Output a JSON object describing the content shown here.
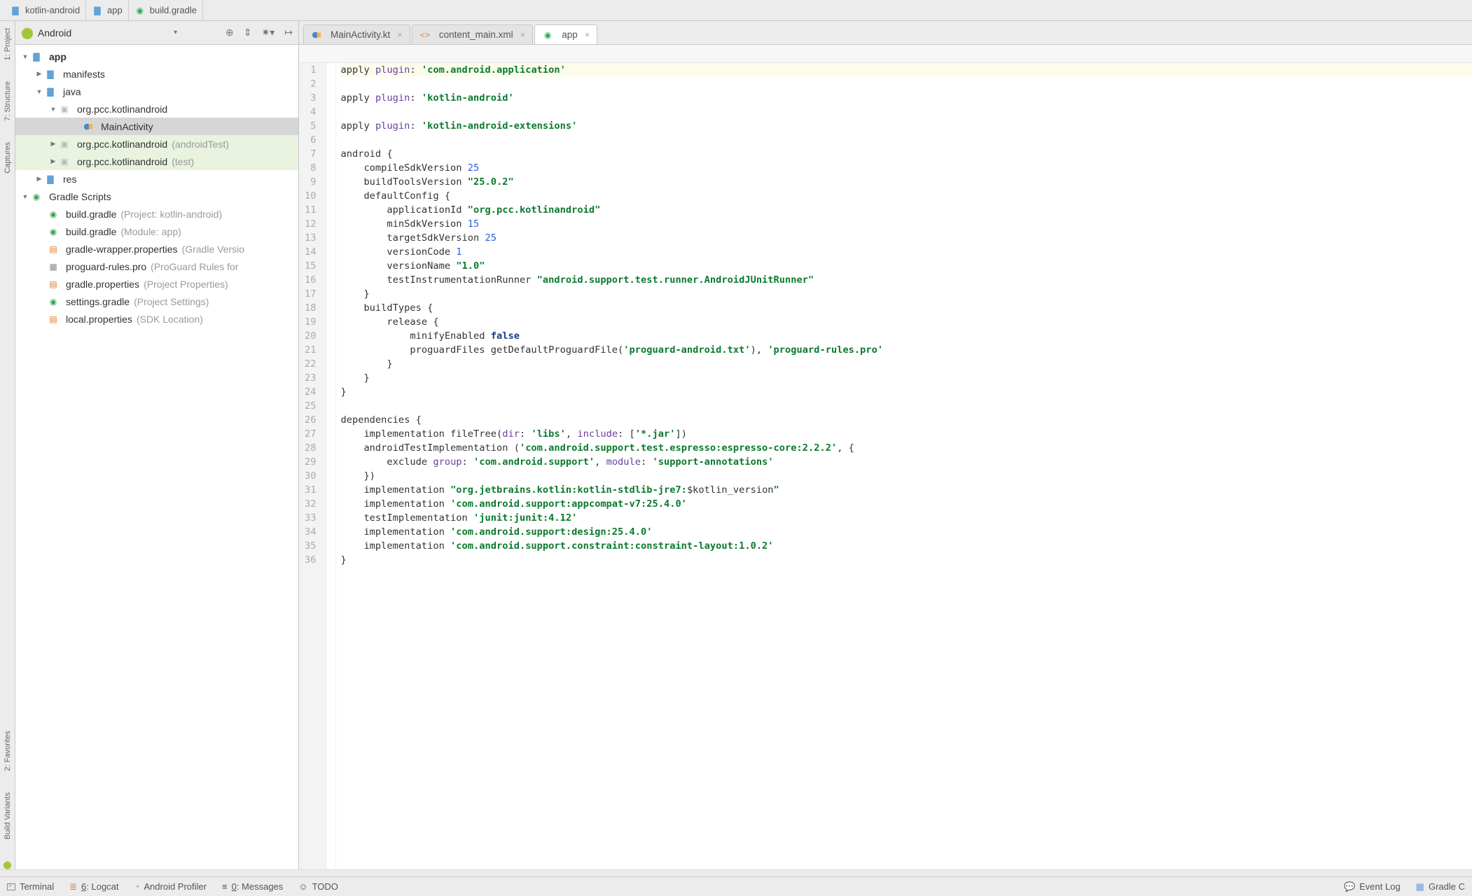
{
  "breadcrumb": {
    "proj": "kotlin-android",
    "mod": "app",
    "file": "build.gradle"
  },
  "projectHeader": {
    "mode": "Android"
  },
  "tree": {
    "app": "app",
    "manifests": "manifests",
    "java": "java",
    "pkg1": "org.pcc.kotlinandroid",
    "main": "MainActivity",
    "pkg2": "org.pcc.kotlinandroid",
    "pkg2q": "(androidTest)",
    "pkg3": "org.pcc.kotlinandroid",
    "pkg3q": "(test)",
    "res": "res",
    "gscripts": "Gradle Scripts",
    "bg1": "build.gradle",
    "bg1q": "(Project: kotlin-android)",
    "bg2": "build.gradle",
    "bg2q": "(Module: app)",
    "gw": "gradle-wrapper.properties",
    "gwq": "(Gradle Versio",
    "pg": "proguard-rules.pro",
    "pgq": "(ProGuard Rules for",
    "gp": "gradle.properties",
    "gpq": "(Project Properties)",
    "sg": "settings.gradle",
    "sgq": "(Project Settings)",
    "lp": "local.properties",
    "lpq": "(SDK Location)"
  },
  "tabs": {
    "t1": "MainActivity.kt",
    "t2": "content_main.xml",
    "t3": "app"
  },
  "code": {
    "l1a": "apply ",
    "l1b": "plugin",
    "l1c": ": ",
    "l1d": "'com.android.application'",
    "l3a": "apply ",
    "l3b": "plugin",
    "l3c": ": ",
    "l3d": "'kotlin-android'",
    "l5a": "apply ",
    "l5b": "plugin",
    "l5c": ": ",
    "l5d": "'kotlin-android-extensions'",
    "l7": "android {",
    "l8a": "    compileSdkVersion ",
    "l8b": "25",
    "l9a": "    buildToolsVersion ",
    "l9b": "\"25.0.2\"",
    "l10": "    defaultConfig {",
    "l11a": "        applicationId ",
    "l11b": "\"org.pcc.kotlinandroid\"",
    "l12a": "        minSdkVersion ",
    "l12b": "15",
    "l13a": "        targetSdkVersion ",
    "l13b": "25",
    "l14a": "        versionCode ",
    "l14b": "1",
    "l15a": "        versionName ",
    "l15b": "\"1.0\"",
    "l16a": "        testInstrumentationRunner ",
    "l16b": "\"android.support.test.runner.AndroidJUnitRunner\"",
    "l17": "    }",
    "l18": "    buildTypes {",
    "l19": "        release {",
    "l20a": "            minifyEnabled ",
    "l20b": "false",
    "l21a": "            proguardFiles getDefaultProguardFile(",
    "l21b": "'proguard-android.txt'",
    "l21c": "), ",
    "l21d": "'proguard-rules.pro'",
    "l22": "        }",
    "l23": "    }",
    "l24": "}",
    "l26": "dependencies {",
    "l27a": "    implementation fileTree(",
    "l27b": "dir",
    "l27c": ": ",
    "l27d": "'libs'",
    "l27e": ", ",
    "l27f": "include",
    "l27g": ": [",
    "l27h": "'*.jar'",
    "l27i": "])",
    "l28a": "    androidTestImplementation (",
    "l28b": "'com.android.support.test.espresso:espresso-core:2.2.2'",
    "l28c": ", {",
    "l29a": "        exclude ",
    "l29b": "group",
    "l29c": ": ",
    "l29d": "'com.android.support'",
    "l29e": ", ",
    "l29f": "module",
    "l29g": ": ",
    "l29h": "'support-annotations'",
    "l30": "    })",
    "l31a": "    implementation ",
    "l31b": "\"org.jetbrains.kotlin:kotlin-stdlib-jre7:",
    "l31c": "$kotlin_version",
    "l31d": "\"",
    "l32a": "    implementation ",
    "l32b": "'com.android.support:appcompat-v7:25.4.0'",
    "l33a": "    testImplementation ",
    "l33b": "'junit:junit:4.12'",
    "l34a": "    implementation ",
    "l34b": "'com.android.support:design:25.4.0'",
    "l35a": "    implementation ",
    "l35b": "'com.android.support.constraint:constraint-layout:1.0.2'",
    "l36": "}"
  },
  "status": {
    "terminal": "Terminal",
    "logcat_u": "6",
    "logcat": ": Logcat",
    "profiler": "Android Profiler",
    "msg_u": "0",
    "msg": ": Messages",
    "todo": "TODO",
    "eventlog": "Event Log",
    "gradle": "Gradle C"
  }
}
